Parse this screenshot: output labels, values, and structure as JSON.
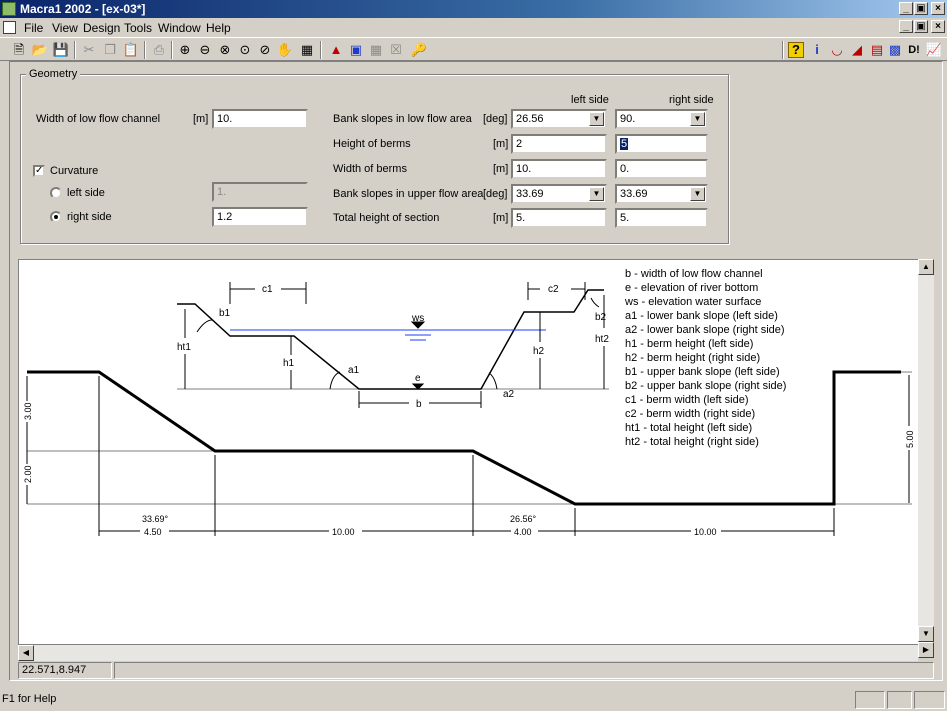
{
  "window": {
    "title": "Macra1 2002 - [ex-03*]"
  },
  "title_buttons": [
    "_",
    "×"
  ],
  "menu": [
    "File",
    "View",
    "Design",
    "Tools",
    "Window",
    "Help"
  ],
  "toolbar": {
    "left_icons": [
      "new-file-icon",
      "open-folder-icon",
      "save-icon",
      "cut-icon",
      "copy-icon",
      "paste-icon",
      "print-icon",
      "zoom-in-icon",
      "zoom-out-icon",
      "zoom-window-icon",
      "zoom-all-icon",
      "zoom-previous-icon",
      "pan-icon",
      "grid-icon",
      "text-icon",
      "window-icon",
      "grid-toggle-icon",
      "close-box-icon",
      "help-icon"
    ],
    "right_icons": [
      "help-box-icon",
      "info-icon",
      "channel-icon",
      "section-icon",
      "layers-icon",
      "database-icon",
      "d-exclaim-icon",
      "chart-icon"
    ]
  },
  "geometry": {
    "group_label": "Geometry",
    "col_left": "left side",
    "col_right": "right side",
    "width_low_flow": {
      "label": "Width of low flow channel",
      "unit": "[m]",
      "value": "10."
    },
    "curvature": {
      "label": "Curvature",
      "checked": true
    },
    "left_side": {
      "label": "left side",
      "value": "1."
    },
    "right_side": {
      "label": "right side",
      "value": "1.2"
    },
    "bank_slopes_low": {
      "label": "Bank slopes in low flow area",
      "unit": "[deg]",
      "left": "26.56",
      "right": "90."
    },
    "height_berms": {
      "label": "Height of berms",
      "unit": "[m]",
      "left": "2",
      "right": "5"
    },
    "width_berms": {
      "label": "Width of berms",
      "unit": "[m]",
      "left": "10.",
      "right": "0."
    },
    "bank_slopes_upper": {
      "label": "Bank slopes in upper flow area",
      "unit": "[deg]",
      "left": "33.69",
      "right": "33.69"
    },
    "total_height": {
      "label": "Total height of section",
      "unit": "[m]",
      "left": "5.",
      "right": "5."
    }
  },
  "diagram": {
    "schematic_labels": {
      "c1": "c1",
      "c2": "c2",
      "ws": "ws",
      "e": "e",
      "b": "b",
      "b1": "b1",
      "b2": "b2",
      "h1": "h1",
      "h2": "h2",
      "ht1": "ht1",
      "ht2": "ht2",
      "a1": "a1",
      "a2": "a2"
    },
    "legend": [
      "b - width of low flow channel",
      "e - elevation of river bottom",
      "ws - elevation water surface",
      "a1 - lower bank slope (left side)",
      "a2 - lower bank slope (right side)",
      "h1 - berm height (left side)",
      "h2 - berm height (right side)",
      "b1 - upper bank slope (left side)",
      "b2 - upper bank slope (right side)",
      "c1 - berm width (left side)",
      "c2 - berm width (right side)",
      "ht1 - total height (left side)",
      "ht2 - total height (right side)"
    ],
    "dims": {
      "vertical_upper": "3.00",
      "vertical_lower": "2.00",
      "vertical_right": "5.00",
      "angle_left": "33.69°",
      "len_left": "4.50",
      "len_berm": "10.00",
      "angle_right": "26.56°",
      "len_right": "4.00",
      "len_bottom": "10.00"
    }
  },
  "coords": "22.571,8.947",
  "status": "F1 for Help",
  "colors": {
    "title_start": "#0a246a",
    "title_end": "#a6caf0",
    "water_line": "#1e3cff",
    "selection": "#0a246a"
  }
}
